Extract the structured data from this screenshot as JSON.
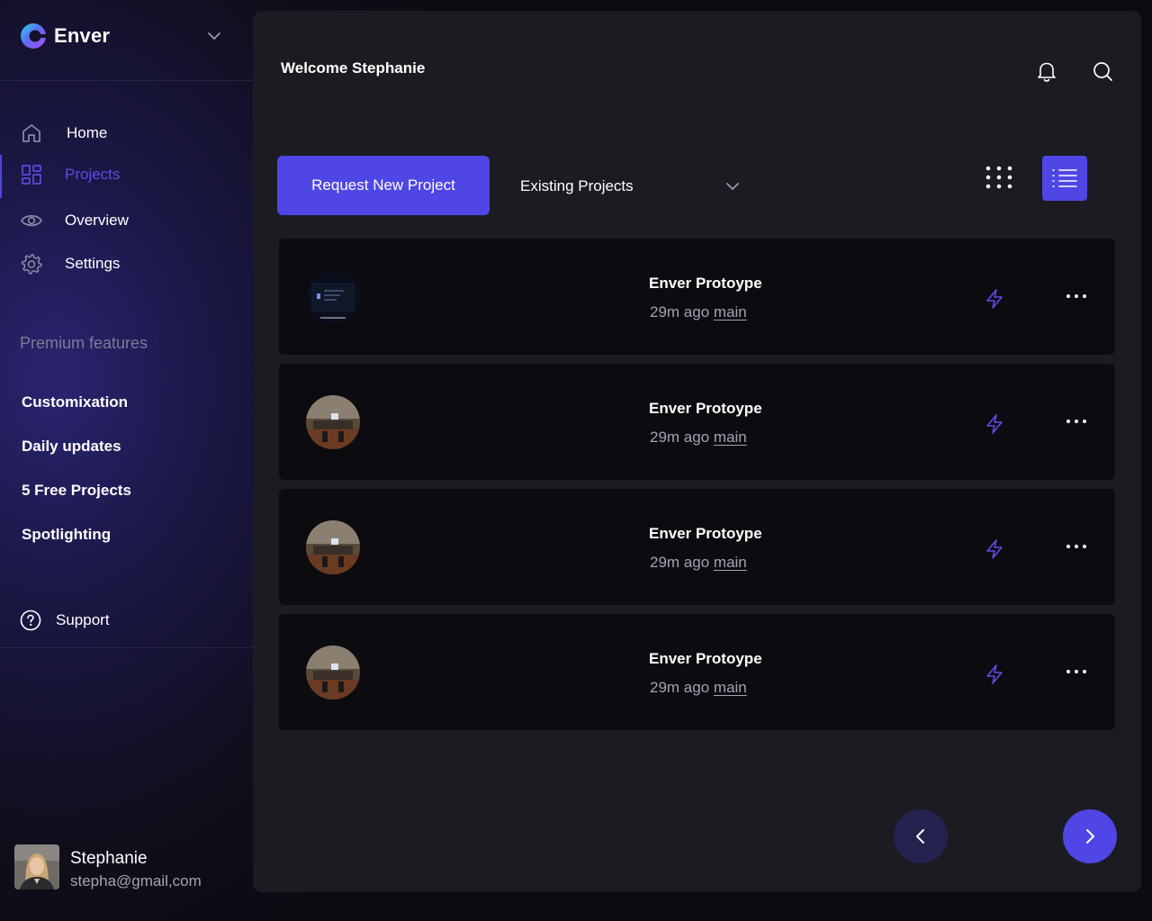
{
  "brand": {
    "name": "Enver"
  },
  "sidebar": {
    "nav": [
      {
        "label": "Home",
        "icon": "home-icon"
      },
      {
        "label": "Projects",
        "icon": "projects-grid-icon",
        "active": true
      },
      {
        "label": "Overview",
        "icon": "eye-icon"
      },
      {
        "label": "Settings",
        "icon": "gear-icon"
      }
    ],
    "premium_title": "Premium features",
    "features": [
      "Customixation",
      "Daily updates",
      "5 Free Projects",
      "Spotlighting"
    ],
    "support_label": "Support"
  },
  "user": {
    "name": "Stephanie",
    "email": "stepha@gmail,com"
  },
  "header": {
    "welcome": "Welcome Stephanie"
  },
  "toolbar": {
    "request_label": "Request New Project",
    "dropdown_value": "Existing Projects"
  },
  "projects": [
    {
      "title": "Enver Protoype",
      "time": "29m ago",
      "branch": "main",
      "thumb": "dark-screen"
    },
    {
      "title": "Enver Protoype",
      "time": "29m ago",
      "branch": "main",
      "thumb": "room-photo"
    },
    {
      "title": "Enver Protoype",
      "time": "29m ago",
      "branch": "main",
      "thumb": "room-photo"
    },
    {
      "title": "Enver Protoype",
      "time": "29m ago",
      "branch": "main",
      "thumb": "room-photo"
    }
  ],
  "colors": {
    "accent": "#4f46e5",
    "active_text": "#5a4de6",
    "panel": "#1c1b21",
    "row": "#0c0b10"
  }
}
